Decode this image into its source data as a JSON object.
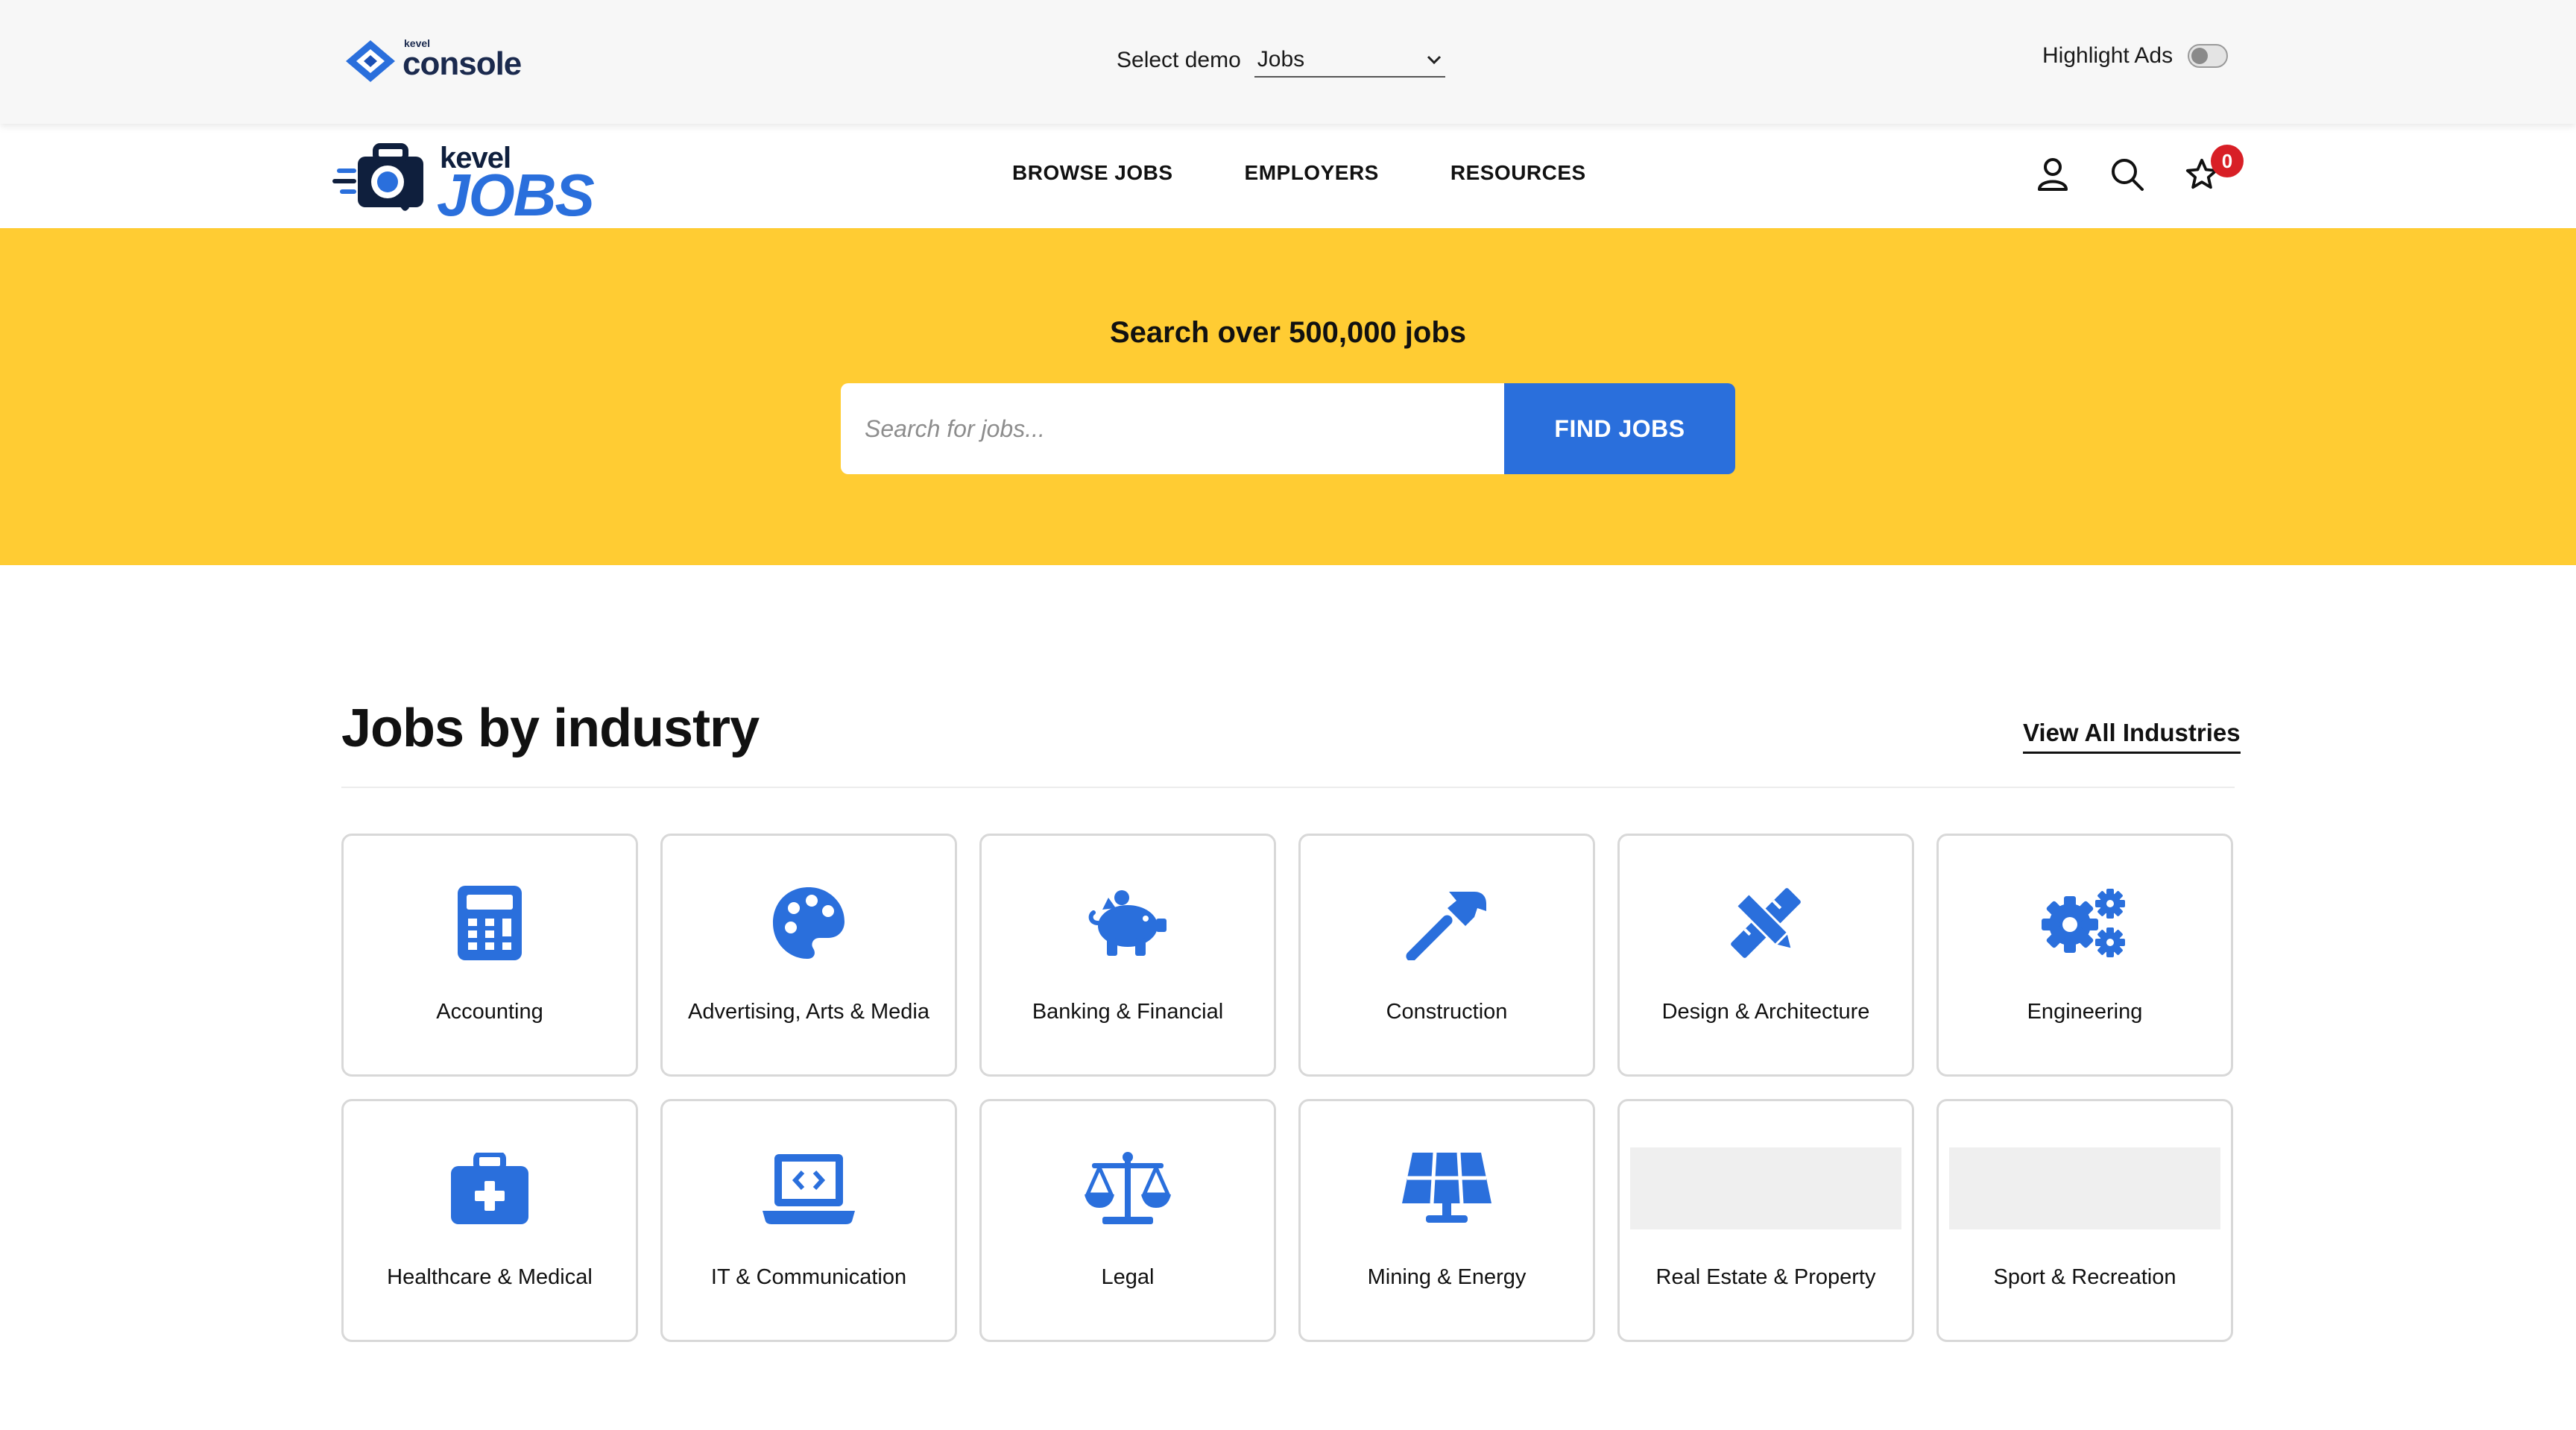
{
  "console": {
    "brand_small": "kevel",
    "brand": "console",
    "demo_label": "Select demo",
    "demo_value": "Jobs",
    "highlight_label": "Highlight Ads"
  },
  "site": {
    "logo_top": "kevel",
    "logo_bottom": "JOBS",
    "nav": [
      "BROWSE JOBS",
      "EMPLOYERS",
      "RESOURCES"
    ],
    "saved_count": "0"
  },
  "hero": {
    "title": "Search over 500,000 jobs",
    "search_placeholder": "Search for jobs...",
    "button_label": "FIND JOBS"
  },
  "industries": {
    "heading": "Jobs by industry",
    "view_all": "View All Industries",
    "items": [
      {
        "label": "Accounting",
        "icon": "calculator-icon"
      },
      {
        "label": "Advertising, Arts & Media",
        "icon": "palette-icon"
      },
      {
        "label": "Banking & Financial",
        "icon": "piggy-bank-icon"
      },
      {
        "label": "Construction",
        "icon": "hammer-icon"
      },
      {
        "label": "Design & Architecture",
        "icon": "pencil-ruler-icon"
      },
      {
        "label": "Engineering",
        "icon": "gears-icon"
      },
      {
        "label": "Healthcare & Medical",
        "icon": "medical-kit-icon"
      },
      {
        "label": "IT & Communication",
        "icon": "laptop-code-icon"
      },
      {
        "label": "Legal",
        "icon": "scales-icon"
      },
      {
        "label": "Mining & Energy",
        "icon": "solar-panel-icon"
      },
      {
        "label": "Real Estate & Property",
        "icon": "image-placeholder"
      },
      {
        "label": "Sport & Recreation",
        "icon": "image-placeholder"
      }
    ]
  },
  "colors": {
    "accent": "#2a6fdc",
    "hero_bg": "#ffcc33",
    "badge": "#d81f26"
  }
}
